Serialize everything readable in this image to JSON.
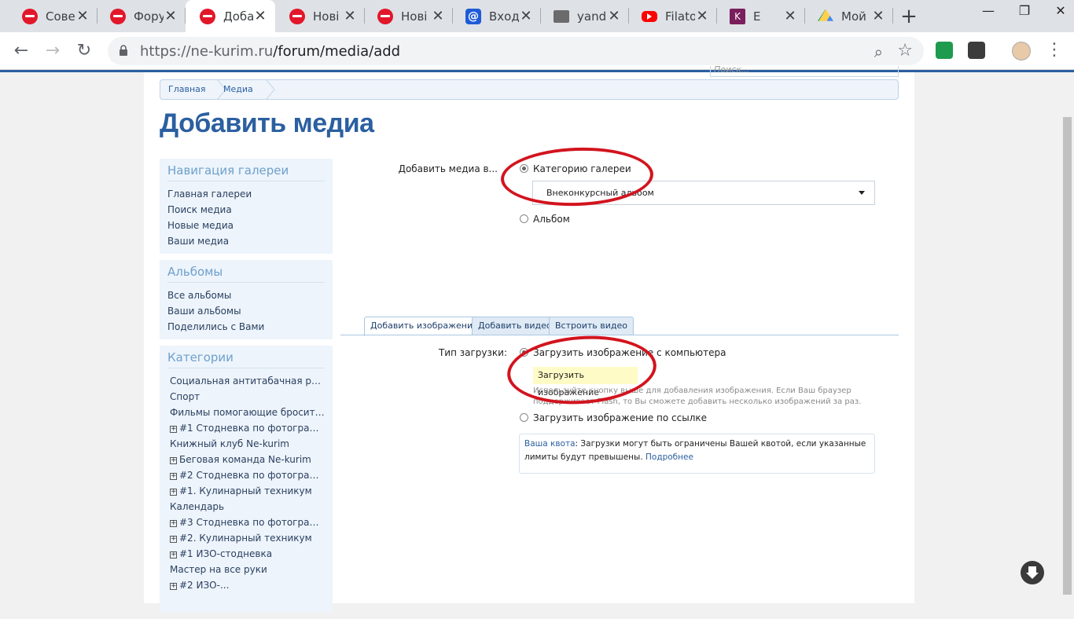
{
  "browser": {
    "tabs": [
      {
        "title": "Сове",
        "favicon": "stop-icon"
      },
      {
        "title": "Фору",
        "favicon": "stop-icon"
      },
      {
        "title": "Доба",
        "favicon": "stop-icon",
        "active": true
      },
      {
        "title": "Нові",
        "favicon": "stop-icon"
      },
      {
        "title": "Нові",
        "favicon": "stop-icon"
      },
      {
        "title": "Вход",
        "favicon": "mail-icon"
      },
      {
        "title": "yand",
        "favicon": "image-icon"
      },
      {
        "title": "Filato",
        "favicon": "youtube-icon"
      },
      {
        "title": "E",
        "favicon": "k-icon"
      },
      {
        "title": "Мой",
        "favicon": "drive-icon"
      }
    ],
    "url_host": "https://ne-kurim.ru",
    "url_path": "/forum/media/add",
    "mail_glyph": "@",
    "k_glyph": "K",
    "newtab_glyph": "+",
    "win_min": "—",
    "win_max": "❐",
    "win_close": "✕"
  },
  "page": {
    "search_placeholder": "Поиск...",
    "breadcrumb": [
      "Главная",
      "Медиа"
    ],
    "title": "Добавить медиа"
  },
  "sidebar": {
    "nav": {
      "title": "Навигация галереи",
      "items": [
        "Главная галереи",
        "Поиск медиа",
        "Новые медиа",
        "Ваши медиа"
      ]
    },
    "albums": {
      "title": "Альбомы",
      "items": [
        "Все альбомы",
        "Ваши альбомы",
        "Поделились с Вами"
      ]
    },
    "categories": {
      "title": "Категории",
      "items": [
        {
          "label": "Социальная антитабачная рек...",
          "expandable": false
        },
        {
          "label": "Спорт",
          "expandable": false
        },
        {
          "label": "Фильмы помогающие бросить ...",
          "expandable": false
        },
        {
          "label": "#1 Стодневка по фотографии",
          "expandable": true
        },
        {
          "label": "Книжный клуб Ne-kurim",
          "expandable": false
        },
        {
          "label": "Беговая команда Ne-kurim",
          "expandable": true
        },
        {
          "label": "#2 Стодневка по фотографии",
          "expandable": true
        },
        {
          "label": "#1. Кулинарный техникум",
          "expandable": true
        },
        {
          "label": "Календарь",
          "expandable": false
        },
        {
          "label": "#3 Стодневка по фотографии",
          "expandable": true
        },
        {
          "label": "#2. Кулинарный техникум",
          "expandable": true
        },
        {
          "label": "#1 ИЗО-стодневка",
          "expandable": true
        },
        {
          "label": "Мастер на все руки",
          "expandable": false
        },
        {
          "label": "#2 ИЗО-...",
          "expandable": true
        }
      ]
    }
  },
  "form": {
    "add_to_label": "Добавить медиа в...",
    "option_category": "Категорию галереи",
    "option_category_selected": true,
    "category_select_value": "Внеконкурсный альбом",
    "option_album": "Альбом",
    "option_album_selected": false,
    "tabs": [
      "Добавить изображение",
      "Добавить видео",
      "Встроить видео"
    ],
    "active_tab": 0,
    "upload_type_label": "Тип загрузки:",
    "option_from_computer": "Загрузить изображение с компьютера",
    "option_from_computer_selected": true,
    "upload_button": "Загрузить изображение",
    "upload_hint": "Используйте кнопку выше для добавления изображения. Если Ваш браузер поддерживает Flash, то Вы сможете добавить несколько изображений за раз.",
    "option_from_url": "Загрузить изображение по ссылке",
    "option_from_url_selected": false,
    "quota_link": "Ваша квота",
    "quota_text": ": Загрузки могут быть ограничены Вашей квотой, если указанные лимиты будут превышены.",
    "quota_more": "Подробнее"
  },
  "colors": {
    "accent": "#2b5fa0",
    "annotation": "#d2141e",
    "upload_button_bg": "#fffbc6"
  }
}
